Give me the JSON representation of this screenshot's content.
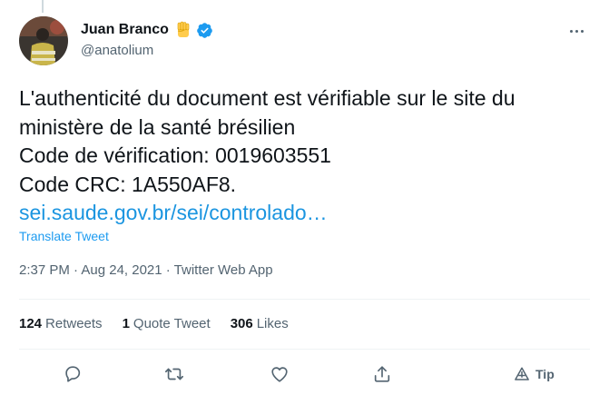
{
  "author": {
    "display_name": "Juan Branco",
    "handle": "@anatolium",
    "emoji_icon": "raised-fist-emoji",
    "verified_icon": "verified-badge-icon",
    "verified_color": "#1d9bf0"
  },
  "tweet": {
    "lines": [
      "L'authenticité du document est vérifiable sur le site du",
      "ministère de la santé brésilien",
      "Code de vérification: 0019603551",
      "Code CRC: 1A550AF8."
    ],
    "link_text": "sei.saude.gov.br/sei/controlado…",
    "translate_label": "Translate Tweet",
    "timestamp": "2:37 PM · Aug 24, 2021 · Twitter Web App"
  },
  "stats": {
    "retweets_count": "124",
    "retweets_label": "Retweets",
    "quotes_count": "1",
    "quotes_label": "Quote Tweet",
    "likes_count": "306",
    "likes_label": "Likes"
  },
  "actions": {
    "reply_icon": "reply-icon",
    "retweet_icon": "retweet-icon",
    "like_icon": "heart-icon",
    "share_icon": "share-icon",
    "tip_icon": "tip-icon",
    "tip_label": "Tip"
  },
  "colors": {
    "link": "#1b95e0",
    "secondary_text": "#536471",
    "primary_text": "#0f1419"
  }
}
